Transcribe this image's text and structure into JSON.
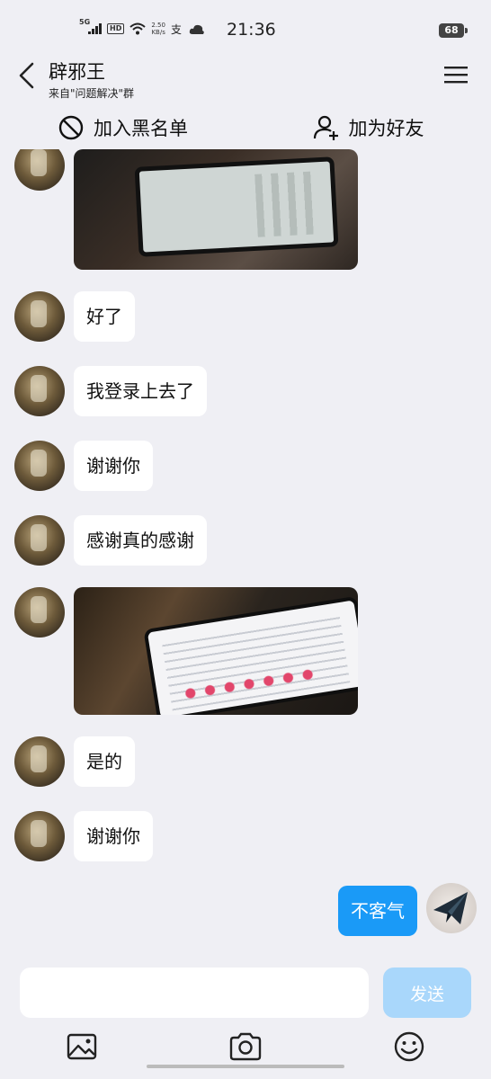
{
  "status_bar": {
    "network": "5G",
    "hd": "HD",
    "speed_value": "2.50",
    "speed_unit": "KB/s",
    "time": "21:36",
    "battery": "68"
  },
  "header": {
    "title": "辟邪王",
    "subtitle": "来自\"问题解决\"群"
  },
  "actions": {
    "block": "加入黑名单",
    "add_friend": "加为好友"
  },
  "messages": [
    {
      "from": "other",
      "type": "image"
    },
    {
      "from": "other",
      "type": "text",
      "text": "好了"
    },
    {
      "from": "other",
      "type": "text",
      "text": "我登录上去了"
    },
    {
      "from": "other",
      "type": "text",
      "text": "谢谢你"
    },
    {
      "from": "other",
      "type": "text",
      "text": "感谢真的感谢"
    },
    {
      "from": "other",
      "type": "image"
    },
    {
      "from": "other",
      "type": "text",
      "text": "是的"
    },
    {
      "from": "other",
      "type": "text",
      "text": "谢谢你"
    },
    {
      "from": "me",
      "type": "text",
      "text": "不客气"
    }
  ],
  "input": {
    "value": "",
    "placeholder": ""
  },
  "send_label": "发送",
  "tools": [
    "image-icon",
    "camera-icon",
    "emoji-icon"
  ],
  "colors": {
    "accent": "#1a9af7",
    "send_disabled": "#a9d7fb",
    "background": "#efeff4"
  }
}
